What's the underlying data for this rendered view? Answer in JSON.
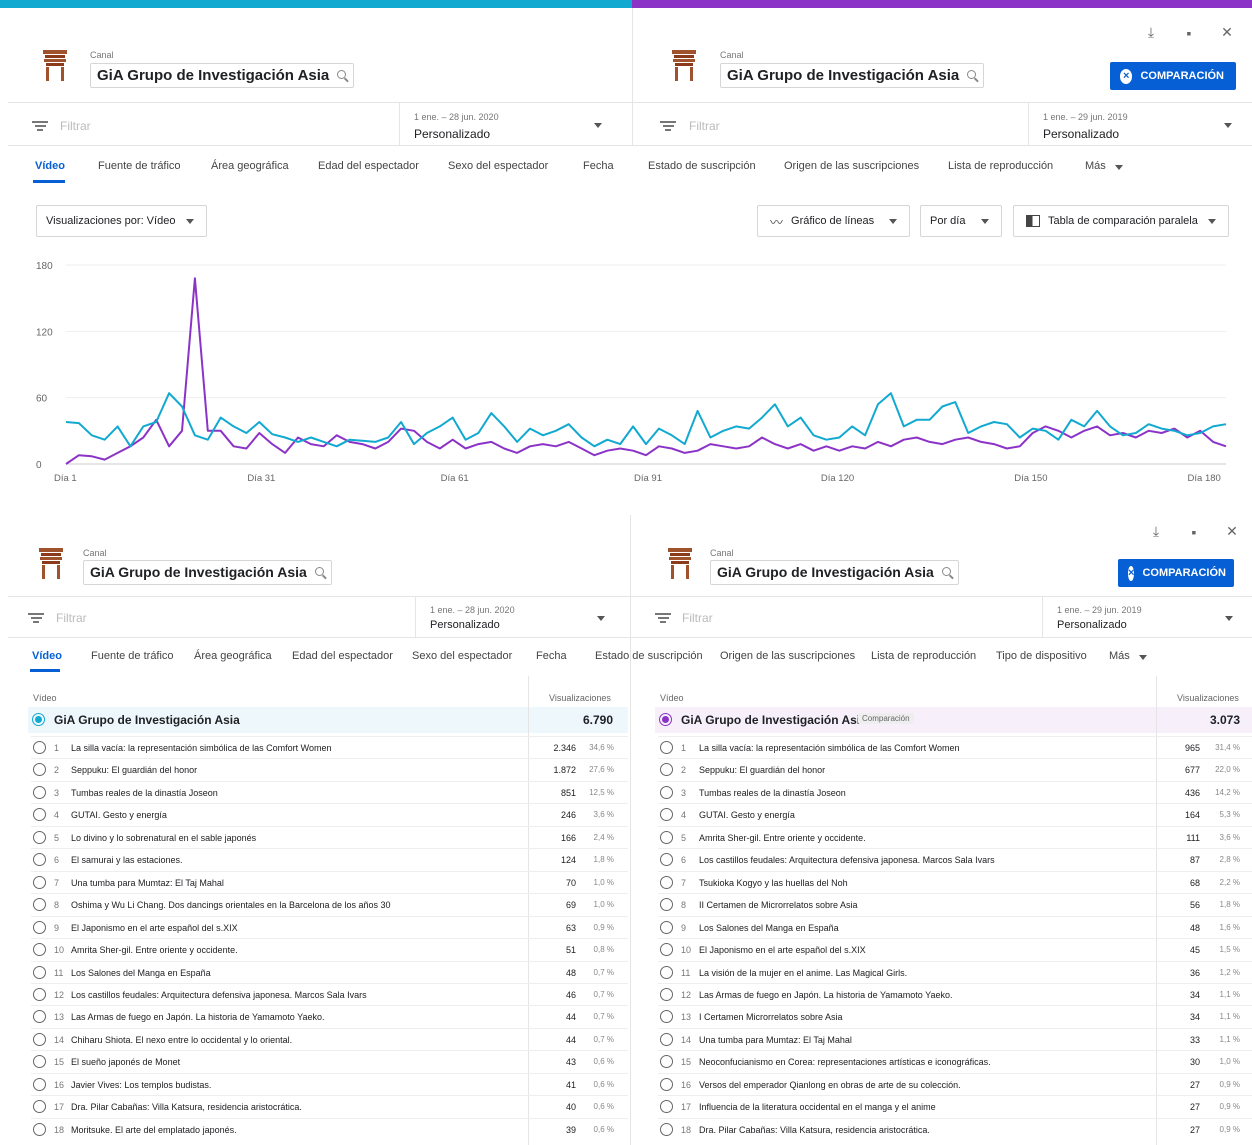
{
  "colors": {
    "current": "#12a9d0",
    "comparison": "#8c33c7",
    "accent": "#065fd4"
  },
  "panel": {
    "canal_label": "Canal",
    "channel_name": "GiA Grupo de Investigación Asia",
    "filter_placeholder": "Filtrar",
    "compare_button": "COMPARACIÓN",
    "left_date_range": "1 ene. – 28 jun. 2020",
    "right_date_range": "1 ene. – 29 jun. 2019",
    "period_type": "Personalizado",
    "icons": [
      "download-icon",
      "feedback-icon",
      "close-icon"
    ]
  },
  "tabs_top": [
    "Vídeo",
    "Fuente de tráfico",
    "Área geográfica",
    "Edad del espectador",
    "Sexo del espectador",
    "Fecha",
    "Estado de suscripción",
    "Origen de las suscripciones",
    "Lista de reproducción",
    "Más"
  ],
  "tabs_bottom": [
    "Vídeo",
    "Fuente de tráfico",
    "Área geográfica",
    "Edad del espectador",
    "Sexo del espectador",
    "Fecha",
    "Estado de suscripción",
    "Origen de las suscripciones",
    "Lista de reproducción",
    "Tipo de dispositivo",
    "Más"
  ],
  "controls": {
    "metric": "Visualizaciones por: Vídeo",
    "chart_type": "Gráfico de líneas",
    "granularity": "Por día",
    "comparison_table": "Tabla de comparación paralela"
  },
  "chart_data": {
    "type": "line",
    "x_labels": [
      "Día 1",
      "Día 31",
      "Día 61",
      "Día 91",
      "Día 120",
      "Día 150",
      "Día 180"
    ],
    "ylim": [
      0,
      180
    ],
    "yticks": [
      0,
      60,
      120,
      180
    ],
    "grid": true,
    "x": [
      1,
      3,
      5,
      7,
      9,
      11,
      13,
      15,
      17,
      19,
      21,
      23,
      25,
      27,
      29,
      31,
      33,
      35,
      37,
      39,
      41,
      43,
      45,
      47,
      49,
      51,
      53,
      55,
      57,
      59,
      61,
      63,
      65,
      67,
      69,
      71,
      73,
      75,
      77,
      79,
      81,
      83,
      85,
      87,
      89,
      91,
      93,
      95,
      97,
      99,
      101,
      103,
      105,
      107,
      109,
      111,
      113,
      115,
      117,
      119,
      121,
      123,
      125,
      127,
      129,
      131,
      133,
      135,
      137,
      139,
      141,
      143,
      145,
      147,
      149,
      151,
      153,
      155,
      157,
      159,
      161,
      163,
      165,
      167,
      169,
      171,
      173,
      175,
      177,
      179,
      181
    ],
    "series": [
      {
        "color": "#12a9d0",
        "values": [
          38,
          37,
          26,
          22,
          34,
          16,
          34,
          38,
          64,
          52,
          26,
          22,
          42,
          34,
          28,
          38,
          27,
          24,
          20,
          24,
          20,
          16,
          22,
          21,
          20,
          24,
          38,
          18,
          28,
          34,
          42,
          22,
          28,
          46,
          34,
          20,
          32,
          26,
          30,
          36,
          24,
          16,
          22,
          18,
          34,
          18,
          32,
          26,
          18,
          48,
          24,
          30,
          34,
          32,
          42,
          54,
          34,
          42,
          26,
          22,
          24,
          34,
          26,
          54,
          64,
          34,
          40,
          40,
          52,
          56,
          28,
          34,
          38,
          36,
          24,
          32,
          30,
          22,
          40,
          34,
          48,
          34,
          26,
          28,
          36,
          32,
          30,
          26,
          28,
          34,
          36
        ]
      },
      {
        "color": "#8c33c7",
        "values": [
          0,
          8,
          7,
          4,
          10,
          16,
          24,
          40,
          16,
          30,
          168,
          30,
          30,
          16,
          14,
          28,
          18,
          10,
          24,
          18,
          16,
          26,
          20,
          18,
          14,
          20,
          32,
          30,
          20,
          14,
          22,
          14,
          18,
          20,
          14,
          10,
          16,
          18,
          16,
          20,
          14,
          8,
          12,
          14,
          12,
          8,
          16,
          14,
          10,
          12,
          18,
          16,
          14,
          16,
          24,
          18,
          14,
          18,
          12,
          16,
          12,
          16,
          14,
          20,
          16,
          22,
          24,
          20,
          18,
          22,
          24,
          20,
          18,
          14,
          16,
          28,
          34,
          30,
          24,
          30,
          34,
          26,
          28,
          24,
          30,
          28,
          32,
          24,
          30,
          20,
          16
        ]
      }
    ]
  },
  "table": {
    "col_video": "Vídeo",
    "col_views": "Visualizaciones",
    "comparison_pill": "Comparación",
    "left_total": "6.790",
    "right_total": "3.073",
    "left_rows": [
      {
        "rank": "1",
        "title": "La silla vacía: la representación simbólica de las Comfort Women",
        "views": "2.346",
        "pct": "34,6 %"
      },
      {
        "rank": "2",
        "title": "Seppuku: El guardián del honor",
        "views": "1.872",
        "pct": "27,6 %"
      },
      {
        "rank": "3",
        "title": "Tumbas reales de la dinastía Joseon",
        "views": "851",
        "pct": "12,5 %"
      },
      {
        "rank": "4",
        "title": "GUTAI. Gesto y energía",
        "views": "246",
        "pct": "3,6 %"
      },
      {
        "rank": "5",
        "title": "Lo divino y lo sobrenatural en el sable japonés",
        "views": "166",
        "pct": "2,4 %"
      },
      {
        "rank": "6",
        "title": "El samurai y las estaciones.",
        "views": "124",
        "pct": "1,8 %"
      },
      {
        "rank": "7",
        "title": "Una tumba para Mumtaz: El Taj Mahal",
        "views": "70",
        "pct": "1,0 %"
      },
      {
        "rank": "8",
        "title": "Oshima y Wu Li Chang. Dos dancings orientales en la Barcelona de los años 30",
        "views": "69",
        "pct": "1,0 %"
      },
      {
        "rank": "9",
        "title": "El Japonismo en el arte español del s.XIX",
        "views": "63",
        "pct": "0,9 %"
      },
      {
        "rank": "10",
        "title": "Amrita Sher-gil. Entre oriente y occidente.",
        "views": "51",
        "pct": "0,8 %"
      },
      {
        "rank": "11",
        "title": "Los Salones del Manga en España",
        "views": "48",
        "pct": "0,7 %"
      },
      {
        "rank": "12",
        "title": "Los castillos feudales: Arquitectura defensiva japonesa. Marcos Sala Ivars",
        "views": "46",
        "pct": "0,7 %"
      },
      {
        "rank": "13",
        "title": "Las Armas de fuego en Japón. La historia de Yamamoto Yaeko.",
        "views": "44",
        "pct": "0,7 %"
      },
      {
        "rank": "14",
        "title": "Chiharu Shiota. El nexo entre lo occidental y lo oriental.",
        "views": "44",
        "pct": "0,7 %"
      },
      {
        "rank": "15",
        "title": "El sueño japonés de Monet",
        "views": "43",
        "pct": "0,6 %"
      },
      {
        "rank": "16",
        "title": "Javier Vives: Los templos budistas.",
        "views": "41",
        "pct": "0,6 %"
      },
      {
        "rank": "17",
        "title": "Dra. Pilar Cabañas: Villa Katsura, residencia aristocrática.",
        "views": "40",
        "pct": "0,6 %"
      },
      {
        "rank": "18",
        "title": "Moritsuke. El arte del emplatado japonés.",
        "views": "39",
        "pct": "0,6 %"
      }
    ],
    "right_rows": [
      {
        "rank": "1",
        "title": "La silla vacía: la representación simbólica de las Comfort Women",
        "views": "965",
        "pct": "31,4 %"
      },
      {
        "rank": "2",
        "title": "Seppuku: El guardián del honor",
        "views": "677",
        "pct": "22,0 %"
      },
      {
        "rank": "3",
        "title": "Tumbas reales de la dinastía Joseon",
        "views": "436",
        "pct": "14,2 %"
      },
      {
        "rank": "4",
        "title": "GUTAI. Gesto y energía",
        "views": "164",
        "pct": "5,3 %"
      },
      {
        "rank": "5",
        "title": "Amrita Sher-gil. Entre oriente y occidente.",
        "views": "111",
        "pct": "3,6 %"
      },
      {
        "rank": "6",
        "title": "Los castillos feudales: Arquitectura defensiva japonesa. Marcos Sala Ivars",
        "views": "87",
        "pct": "2,8 %"
      },
      {
        "rank": "7",
        "title": "Tsukioka Kogyo y las huellas del Noh",
        "views": "68",
        "pct": "2,2 %"
      },
      {
        "rank": "8",
        "title": "II Certamen de Microrrelatos sobre Asia",
        "views": "56",
        "pct": "1,8 %"
      },
      {
        "rank": "9",
        "title": "Los Salones del Manga en España",
        "views": "48",
        "pct": "1,6 %"
      },
      {
        "rank": "10",
        "title": "El Japonismo en el arte español del s.XIX",
        "views": "45",
        "pct": "1,5 %"
      },
      {
        "rank": "11",
        "title": "La visión de la mujer en el anime. Las Magical Girls.",
        "views": "36",
        "pct": "1,2 %"
      },
      {
        "rank": "12",
        "title": "Las Armas de fuego en Japón. La historia de Yamamoto Yaeko.",
        "views": "34",
        "pct": "1,1 %"
      },
      {
        "rank": "13",
        "title": "I Certamen Microrrelatos sobre Asia",
        "views": "34",
        "pct": "1,1 %"
      },
      {
        "rank": "14",
        "title": "Una tumba para Mumtaz: El Taj Mahal",
        "views": "33",
        "pct": "1,1 %"
      },
      {
        "rank": "15",
        "title": "Neoconfucianismo en Corea: representaciones artísticas e iconográficas.",
        "views": "30",
        "pct": "1,0 %"
      },
      {
        "rank": "16",
        "title": "Versos del emperador Qianlong en obras de arte de su colección.",
        "views": "27",
        "pct": "0,9 %"
      },
      {
        "rank": "17",
        "title": "Influencia de la literatura occidental en el manga y el anime",
        "views": "27",
        "pct": "0,9 %"
      },
      {
        "rank": "18",
        "title": "Dra. Pilar Cabañas: Villa Katsura, residencia aristocrática.",
        "views": "27",
        "pct": "0,9 %"
      }
    ]
  }
}
